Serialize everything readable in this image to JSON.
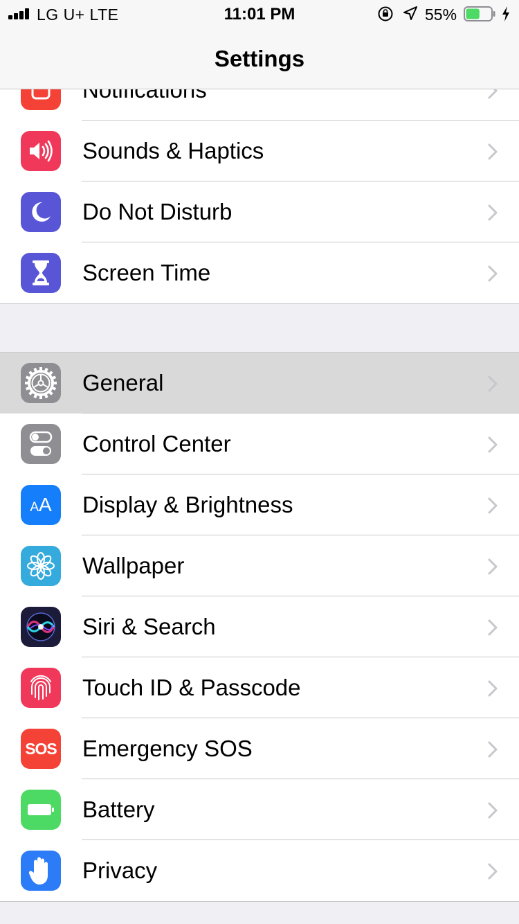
{
  "status_bar": {
    "carrier": "LG U+  LTE",
    "time": "11:01 PM",
    "battery_percent": "55%",
    "battery_level": 0.55,
    "battery_color": "#4cd964"
  },
  "nav": {
    "title": "Settings"
  },
  "group1": [
    {
      "label": "Notifications",
      "icon": "notifications-icon",
      "color": "#f44336"
    },
    {
      "label": "Sounds & Haptics",
      "icon": "speaker-icon",
      "color": "#f0395a"
    },
    {
      "label": "Do Not Disturb",
      "icon": "moon-icon",
      "color": "#5856d6"
    },
    {
      "label": "Screen Time",
      "icon": "hourglass-icon",
      "color": "#5856d6"
    }
  ],
  "group2": [
    {
      "label": "General",
      "icon": "gear-icon",
      "color": "#8e8e93",
      "selected": true
    },
    {
      "label": "Control Center",
      "icon": "toggles-icon",
      "color": "#8e8e93"
    },
    {
      "label": "Display & Brightness",
      "icon": "text-size-icon",
      "color": "#147efb",
      "icon_text": "AA"
    },
    {
      "label": "Wallpaper",
      "icon": "flower-icon",
      "color": "#35aadc"
    },
    {
      "label": "Siri & Search",
      "icon": "siri-icon",
      "color": "#1c1c3a"
    },
    {
      "label": "Touch ID & Passcode",
      "icon": "fingerprint-icon",
      "color": "#f0395a"
    },
    {
      "label": "Emergency SOS",
      "icon": "sos-icon",
      "color": "#f44336",
      "icon_text": "SOS"
    },
    {
      "label": "Battery",
      "icon": "battery-icon",
      "color": "#4cd964"
    },
    {
      "label": "Privacy",
      "icon": "hand-icon",
      "color": "#2b7cf6"
    }
  ]
}
